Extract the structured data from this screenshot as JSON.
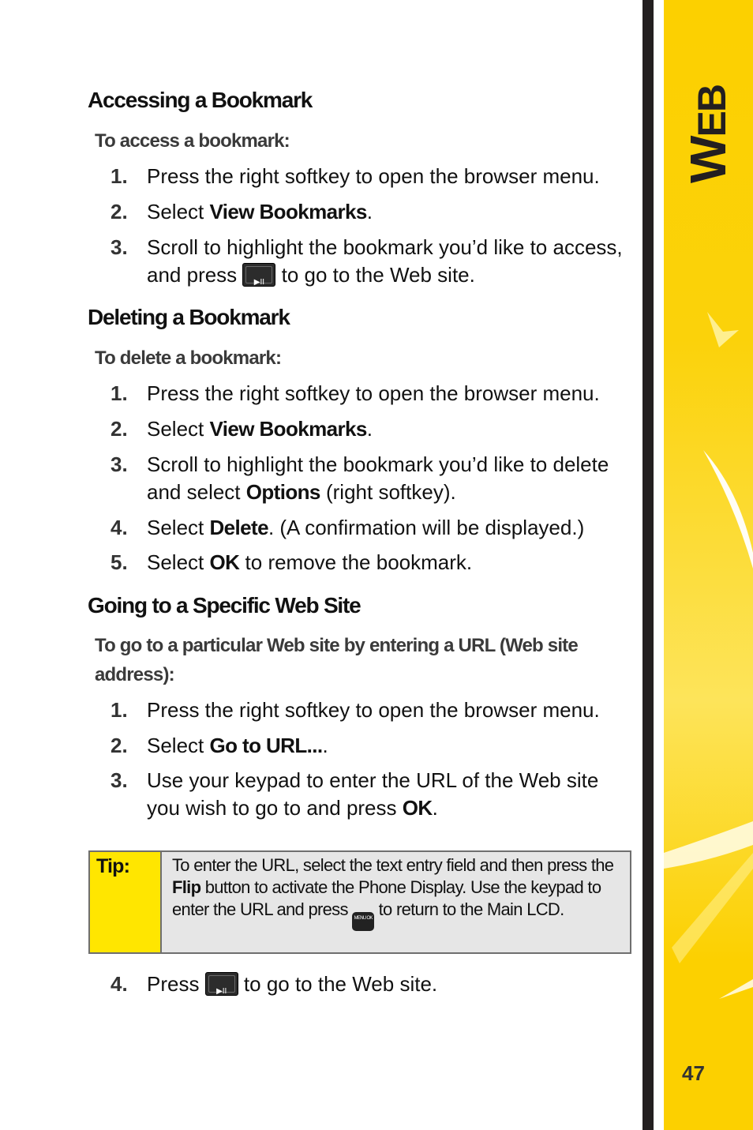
{
  "sidebar": {
    "section_title_first": "W",
    "section_title_rest": "EB",
    "page_number": "47",
    "accent_color": "#fcd000"
  },
  "sections": [
    {
      "heading": "Accessing a Bookmark",
      "intro": "To access a bookmark:",
      "steps": [
        {
          "num": "1.",
          "pre": "Press the right softkey to open the browser menu.",
          "bold": "",
          "post": ""
        },
        {
          "num": "2.",
          "pre": "Select ",
          "bold": "View Bookmarks",
          "post": "."
        },
        {
          "num": "3.",
          "pre": "Scroll to highlight the bookmark you’d like to access, and press ",
          "icon": "play-pause-key-icon",
          "post": " to go to the Web site."
        }
      ]
    },
    {
      "heading": "Deleting a Bookmark",
      "intro": "To delete a bookmark:",
      "steps": [
        {
          "num": "1.",
          "pre": "Press the right softkey to open the browser menu.",
          "bold": "",
          "post": ""
        },
        {
          "num": "2.",
          "pre": "Select ",
          "bold": "View Bookmarks",
          "post": "."
        },
        {
          "num": "3.",
          "pre": "Scroll to highlight the bookmark you’d like to delete and select ",
          "bold": "Options",
          "post": " (right softkey)."
        },
        {
          "num": "4.",
          "pre": "Select ",
          "bold": "Delete",
          "post": ". (A confirmation will be displayed.)"
        },
        {
          "num": "5.",
          "pre": "Select ",
          "bold": "OK",
          "post": " to remove the bookmark."
        }
      ]
    },
    {
      "heading": "Going to a Specific Web Site",
      "intro": "To go to a particular Web site by entering a URL (Web site address):",
      "steps": [
        {
          "num": "1.",
          "pre": "Press the right softkey to open the browser menu.",
          "bold": "",
          "post": ""
        },
        {
          "num": "2.",
          "pre": "Select ",
          "bold": "Go to URL...",
          "post": "."
        },
        {
          "num": "3.",
          "pre": "Use your keypad to enter the URL of the Web site you wish to go to and press ",
          "bold": "OK",
          "post": "."
        },
        {
          "num": "4.",
          "pre": "Press ",
          "icon": "play-pause-key-icon",
          "post": " to go to the Web site."
        }
      ]
    }
  ],
  "tip": {
    "label": "Tip:",
    "part1": "To enter the URL, select the text entry field and then press the ",
    "bold": "Flip",
    "part2": " button to activate the Phone Display. Use the keypad to enter the URL and press ",
    "menu_key_label": "MENU OK",
    "part3": " to return to the Main LCD."
  },
  "key_glyph": "▶II"
}
